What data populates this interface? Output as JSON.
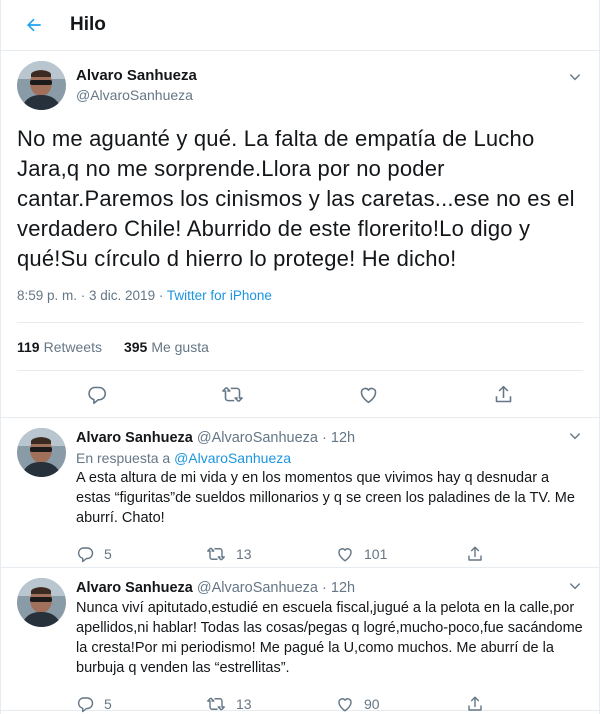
{
  "header": {
    "title": "Hilo"
  },
  "main_tweet": {
    "name": "Alvaro Sanhueza",
    "handle": "@AlvaroSanhueza",
    "text": "No me aguanté y qué. La falta de empatía de Lucho Jara,q no me sorprende.Llora por no poder cantar.Paremos los cinismos y las caretas...ese no es el verdadero Chile! Aburrido de este florerito!Lo digo y qué!Su círculo d hierro lo protege! He dicho!",
    "datetime": "8:59 p. m. · 3 dic. 2019 · ",
    "source": "Twitter for iPhone",
    "retweets_count": "119",
    "retweets_label": "Retweets",
    "likes_count": "395",
    "likes_label": "Me gusta"
  },
  "replies": [
    {
      "name": "Alvaro Sanhueza",
      "handle": "@AlvaroSanhueza",
      "time": "· 12h",
      "in_reply_prefix": "En respuesta a ",
      "in_reply_mention": "@AlvaroSanhueza",
      "text": "A esta altura de mi vida y en los momentos que vivimos hay q desnudar a estas “figuritas”de sueldos millonarios y q se creen los paladines de la TV. Me aburrí. Chato!",
      "replies_count": "5",
      "retweets_count": "13",
      "likes_count": "101"
    },
    {
      "name": "Alvaro Sanhueza",
      "handle": "@AlvaroSanhueza",
      "time": "· 12h",
      "text": "Nunca viví apitutado,estudié en escuela fiscal,jugué a la pelota en la calle,por apellidos,ni hablar! Todas las cosas/pegas q logré,mucho-poco,fue sacándome la cresta!Por mi periodismo! Me pagué la U,como muchos. Me aburrí de la burbuja q venden las “estrellitas”.",
      "replies_count": "5",
      "retweets_count": "13",
      "likes_count": "90"
    }
  ],
  "icons": {
    "back": "back-arrow-icon",
    "caret": "chevron-down-icon",
    "reply": "reply-icon",
    "retweet": "retweet-icon",
    "like": "heart-icon",
    "share": "share-icon"
  },
  "colors": {
    "accent": "#1da1f2",
    "text": "#14171a",
    "secondary": "#657786",
    "border": "#e6ecf0"
  }
}
